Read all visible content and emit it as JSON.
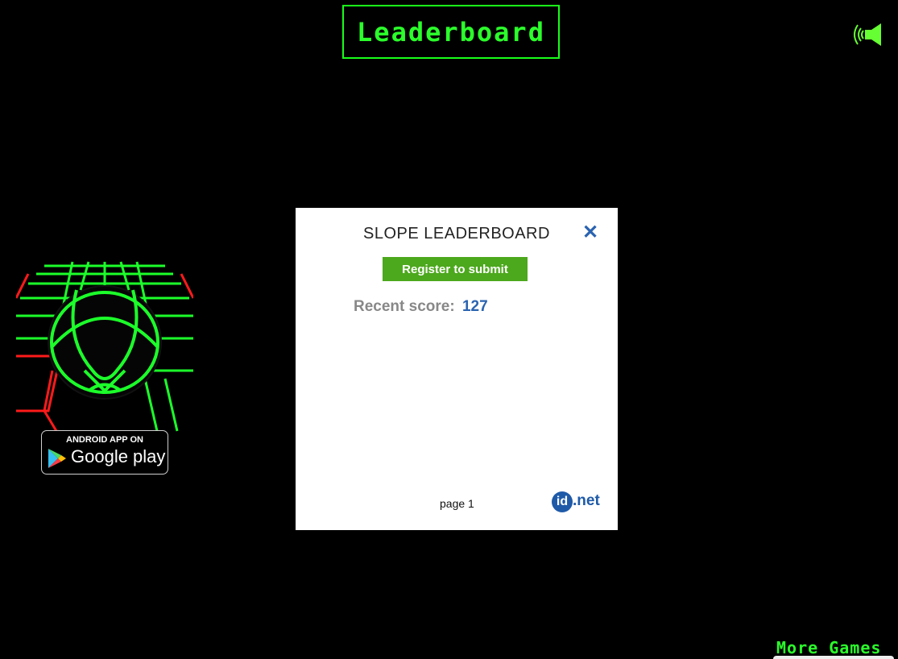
{
  "header": {
    "title": "Leaderboard"
  },
  "sound": {
    "icon": "speaker-icon",
    "color": "#66ff33"
  },
  "promo": {
    "badge_top": "ANDROID APP ON",
    "badge_bottom": "Google play",
    "icon": "google-play-icon"
  },
  "modal": {
    "title": "SLOPE LEADERBOARD",
    "close_icon": "close-icon",
    "register_label": "Register to submit",
    "recent_label": "Recent score:",
    "recent_value": "127",
    "page_label": "page 1",
    "logo_id": "id",
    "logo_suffix": ".net"
  },
  "footer": {
    "more_games": "More Games"
  },
  "colors": {
    "accent": "#19ff19",
    "button": "#4ca81c",
    "link": "#2a63b0",
    "logo": "#1e5aa8"
  }
}
